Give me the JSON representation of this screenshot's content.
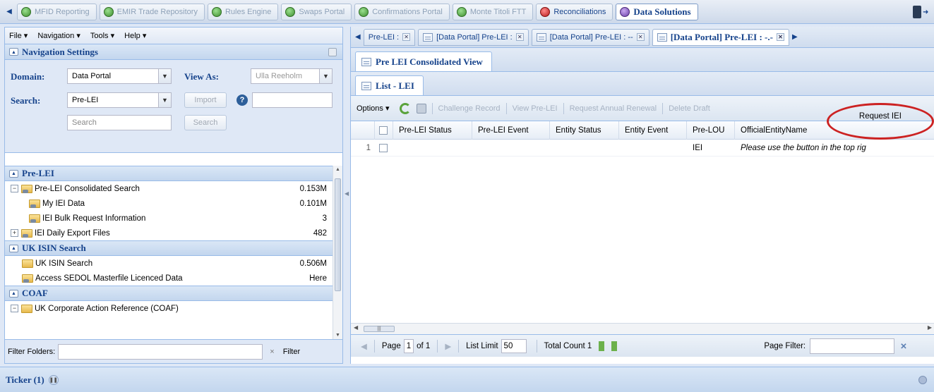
{
  "app_tabs": [
    {
      "label": "MFID Reporting",
      "style": "green"
    },
    {
      "label": "EMIR Trade Repository",
      "style": "green"
    },
    {
      "label": "Rules Engine",
      "style": "green"
    },
    {
      "label": "Swaps Portal",
      "style": "green"
    },
    {
      "label": "Confirmations Portal",
      "style": "green"
    },
    {
      "label": "Monte Titoli FTT",
      "style": "green"
    },
    {
      "label": "Reconciliations",
      "style": "red"
    },
    {
      "label": "Data Solutions",
      "style": "purple"
    }
  ],
  "menu": {
    "file": "File ▾",
    "navigation": "Navigation ▾",
    "tools": "Tools ▾",
    "help": "Help ▾"
  },
  "nav_settings": {
    "title": "Navigation Settings",
    "domain_label": "Domain:",
    "domain_value": "Data Portal",
    "view_as_label": "View As:",
    "view_as_value": "Ulla Reeholm",
    "search_label": "Search:",
    "search_value": "Pre-LEI",
    "import_label": "Import",
    "search_placeholder": "Search",
    "search_button": "Search"
  },
  "tree": {
    "sections": [
      {
        "title": "Pre-LEI"
      },
      {
        "title": "UK ISIN Search"
      },
      {
        "title": "COAF"
      }
    ],
    "items": [
      {
        "label": "Pre-LEI Consolidated Search",
        "value": "0.153M"
      },
      {
        "label": "My IEI Data",
        "value": "0.101M"
      },
      {
        "label": "IEI Bulk Request Information",
        "value": "3"
      },
      {
        "label": "IEI Daily Export Files",
        "value": "482"
      },
      {
        "label": "UK ISIN Search",
        "value": "0.506M"
      },
      {
        "label": "Access SEDOL Masterfile Licenced Data",
        "value": "Here"
      },
      {
        "label": "UK Corporate Action Reference (COAF)",
        "value": ""
      }
    ]
  },
  "filter": {
    "label": "Filter Folders:",
    "clear": "×",
    "button": "Filter"
  },
  "doc_tabs": [
    {
      "label": "Pre-LEI :"
    },
    {
      "label": "[Data Portal] Pre-LEI :"
    },
    {
      "label": "[Data Portal] Pre-LEI : --"
    },
    {
      "label": "[Data Portal] Pre-LEI : -.-"
    }
  ],
  "view_tab": "Pre LEI Consolidated View",
  "list_tab": "List - LEI",
  "toolbar": {
    "options": "Options ▾",
    "challenge": "Challenge Record",
    "view": "View Pre-LEI",
    "renewal": "Request Annual Renewal",
    "delete": "Delete Draft",
    "request": "Request IEI"
  },
  "grid": {
    "columns": [
      "Pre-LEI Status",
      "Pre-LEI Event",
      "Entity Status",
      "Entity Event",
      "Pre-LOU",
      "OfficialEntityName"
    ],
    "rows": [
      {
        "num": "1",
        "pre_lou": "IEI",
        "name": "Please use the button in the top rig"
      }
    ]
  },
  "pager": {
    "page_label": "Page",
    "page_value": "1",
    "of_label": "of 1",
    "limit_label": "List Limit",
    "limit_value": "50",
    "total_label": "Total Count 1",
    "filter_label": "Page Filter:"
  },
  "ticker": {
    "label": "Ticker (1)"
  },
  "colors": {
    "accent": "#15428b",
    "annotation": "#cc2222"
  }
}
